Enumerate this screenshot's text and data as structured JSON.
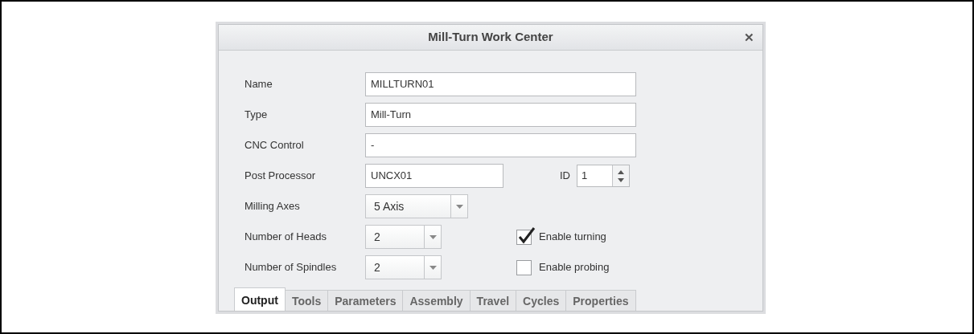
{
  "window": {
    "title": "Mill-Turn Work Center",
    "close": "✕"
  },
  "rows": [
    {
      "label": "Name",
      "kind": "text",
      "value": "MILLTURN01"
    },
    {
      "label": "Type",
      "kind": "text",
      "value": "Mill-Turn"
    },
    {
      "label": "CNC Control",
      "kind": "text",
      "value": "-"
    },
    {
      "label": "Post Processor",
      "kind": "short_text",
      "value": "UNCX01",
      "side": {
        "kind": "spinner",
        "label": "ID",
        "value": "1"
      }
    },
    {
      "label": "Milling Axes",
      "kind": "combo",
      "value": "5 Axis"
    },
    {
      "label": "Number of Heads",
      "kind": "small_combo",
      "value": "2",
      "side": {
        "kind": "checkbox",
        "label": "Enable turning",
        "checked": true
      }
    },
    {
      "label": "Number of Spindles",
      "kind": "small_combo",
      "value": "2",
      "side": {
        "kind": "checkbox",
        "label": "Enable probing",
        "checked": false
      }
    }
  ],
  "tabs": [
    {
      "label": "Output",
      "selected": true
    },
    {
      "label": "Tools",
      "selected": false
    },
    {
      "label": "Parameters",
      "selected": false
    },
    {
      "label": "Assembly",
      "selected": false
    },
    {
      "label": "Travel",
      "selected": false
    },
    {
      "label": "Cycles",
      "selected": false
    },
    {
      "label": "Properties",
      "selected": false
    }
  ]
}
